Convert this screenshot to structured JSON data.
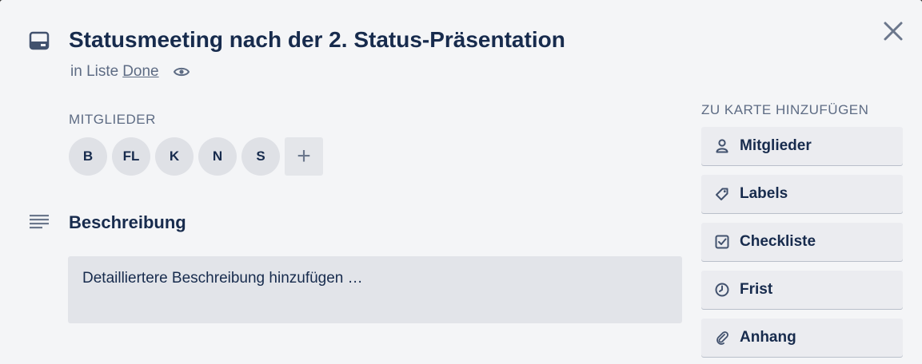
{
  "card": {
    "title": "Statusmeeting nach der 2. Status-Präsentation",
    "in_list_prefix": "in Liste",
    "list_name": "Done"
  },
  "members": {
    "heading": "MITGLIEDER",
    "avatars": [
      "B",
      "FL",
      "K",
      "N",
      "S"
    ],
    "add_label": "+"
  },
  "description": {
    "heading": "Beschreibung",
    "placeholder": "Detailliertere Beschreibung hinzufügen …"
  },
  "sidebar": {
    "heading": "ZU KARTE HINZUFÜGEN",
    "buttons": [
      {
        "label": "Mitglieder",
        "icon": "person-icon"
      },
      {
        "label": "Labels",
        "icon": "tag-icon"
      },
      {
        "label": "Checkliste",
        "icon": "checkbox-icon"
      },
      {
        "label": "Frist",
        "icon": "clock-icon"
      },
      {
        "label": "Anhang",
        "icon": "paperclip-icon"
      }
    ]
  },
  "colors": {
    "background": "#f4f5f7",
    "text_primary": "#172b4d",
    "text_secondary": "#5e6c84",
    "button_bg": "#ebecf0"
  }
}
